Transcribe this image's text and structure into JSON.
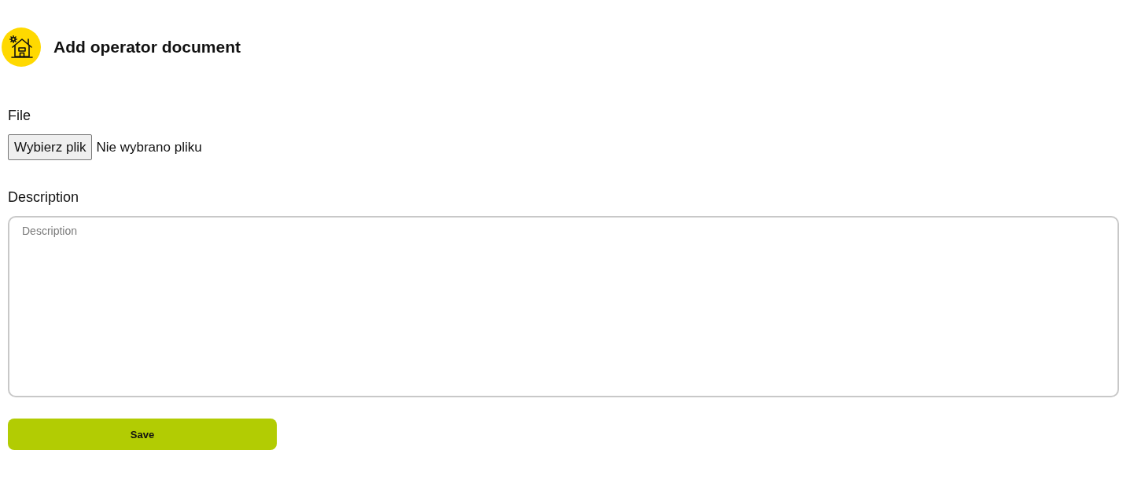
{
  "header": {
    "title": "Add operator document"
  },
  "form": {
    "file": {
      "label": "File",
      "button": "Wybierz plik",
      "status": "Nie wybrano pliku"
    },
    "description": {
      "label": "Description",
      "placeholder": "Description"
    },
    "save_button": "Save"
  }
}
